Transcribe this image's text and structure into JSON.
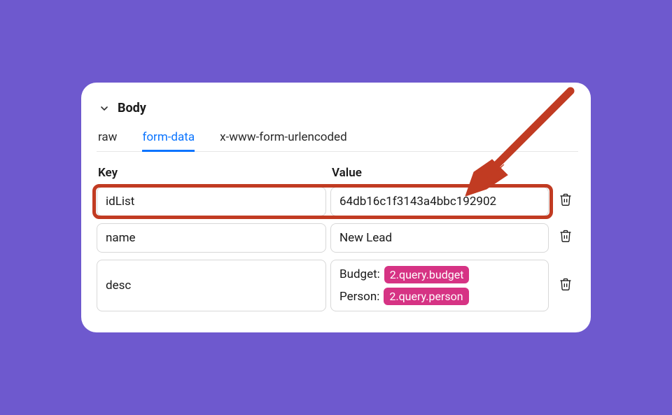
{
  "section": {
    "title": "Body"
  },
  "tabs": [
    {
      "id": "raw",
      "label": "raw",
      "active": false
    },
    {
      "id": "form-data",
      "label": "form-data",
      "active": true
    },
    {
      "id": "urlencoded",
      "label": "x-www-form-urlencoded",
      "active": false
    }
  ],
  "columns": {
    "key_header": "Key",
    "value_header": "Value"
  },
  "rows": [
    {
      "key": "idList",
      "value_text": "64db16c1f3143a4bbc192902",
      "highlighted": true
    },
    {
      "key": "name",
      "value_text": "New Lead",
      "highlighted": false
    },
    {
      "key": "desc",
      "desc_lines": [
        {
          "label": "Budget:",
          "token": "2.query.budget"
        },
        {
          "label": "Person:",
          "token": "2.query.person"
        }
      ],
      "highlighted": false
    }
  ],
  "annotation": {
    "arrow_color": "#C13B22"
  }
}
